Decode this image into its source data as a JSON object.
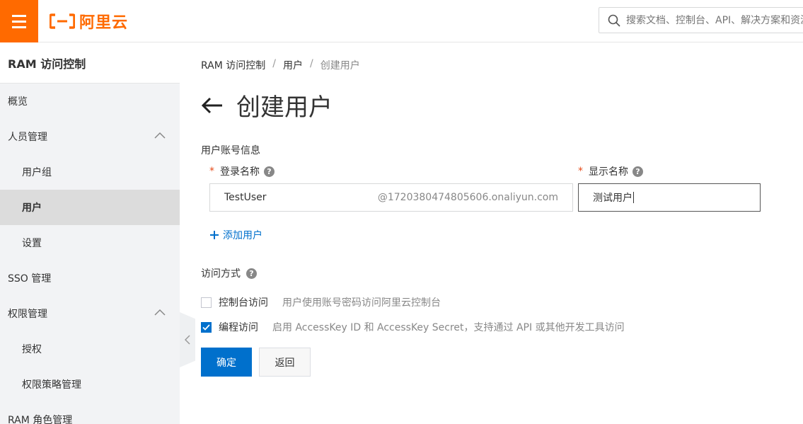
{
  "header": {
    "logo_text": "阿里云",
    "search_placeholder": "搜索文档、控制台、API、解决方案和资源"
  },
  "sidebar": {
    "title": "RAM 访问控制",
    "items": [
      {
        "label": "概览"
      },
      {
        "label": "人员管理"
      },
      {
        "label": "用户组"
      },
      {
        "label": "用户"
      },
      {
        "label": "设置"
      },
      {
        "label": "SSO 管理"
      },
      {
        "label": "权限管理"
      },
      {
        "label": "授权"
      },
      {
        "label": "权限策略管理"
      },
      {
        "label": "RAM 角色管理"
      }
    ]
  },
  "breadcrumb": {
    "items": [
      "RAM 访问控制",
      "用户",
      "创建用户"
    ],
    "separator": "/"
  },
  "page": {
    "title": "创建用户",
    "section_label": "用户账号信息",
    "login_name_label": "登录名称",
    "login_name_value": "TestUser",
    "login_name_suffix": "@1720380474805606.onaliyun.com",
    "display_name_label": "显示名称",
    "display_name_value": "测试用户",
    "required_mark": "*",
    "help_mark": "?",
    "add_user_label": "添加用户",
    "access_label": "访问方式",
    "console_access_title": "控制台访问",
    "console_access_desc": "用户使用账号密码访问阿里云控制台",
    "console_access_checked": false,
    "program_access_title": "编程访问",
    "program_access_desc": "启用 AccessKey ID 和 AccessKey Secret，支持通过 API 或其他开发工具访问",
    "program_access_checked": true,
    "confirm_label": "确定",
    "back_label": "返回"
  },
  "colors": {
    "brand": "#ff6a00",
    "primary": "#0070cc"
  }
}
